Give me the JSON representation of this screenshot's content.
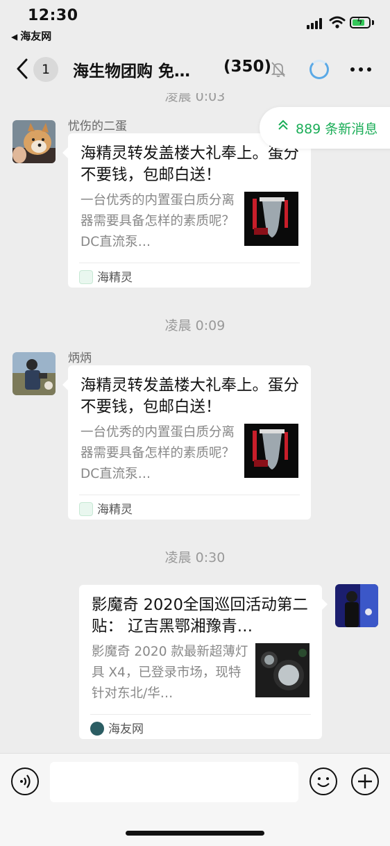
{
  "status_bar": {
    "time": "12:30",
    "back_app": "海友网"
  },
  "nav": {
    "unread_count": "1",
    "title": "海生物团购  免…",
    "member_count": "(350)",
    "icons": [
      "chevron-left-icon",
      "bell-muted-icon",
      "loading-icon",
      "more-icon"
    ]
  },
  "new_messages_pill": "889 条新消息",
  "messages": [
    {
      "timestamp": "凌晨 0:03",
      "sender": "忧伤的二蛋",
      "card": {
        "title": "海精灵转发盖楼大礼奉上。蛋分不要钱，包邮白送！",
        "description": "一台优秀的内置蛋白质分离器需要具备怎样的素质呢？DC直流泵…",
        "source": "海精灵"
      }
    },
    {
      "timestamp": "凌晨 0:09",
      "sender": "炳炳",
      "card": {
        "title": "海精灵转发盖楼大礼奉上。蛋分不要钱，包邮白送！",
        "description": "一台优秀的内置蛋白质分离器需要具备怎样的素质呢？DC直流泵…",
        "source": "海精灵"
      }
    },
    {
      "timestamp": "凌晨 0:30",
      "sender": "",
      "card": {
        "title": "影魔奇 2020全国巡回活动第二贴：  辽吉黑鄂湘豫青…",
        "description": "影魔奇 2020 款最新超薄灯具 X4，已登录市场，现特针对东北/华…",
        "source": "海友网"
      }
    }
  ],
  "input": {
    "placeholder": "",
    "value": ""
  },
  "colors": {
    "accent_green": "#1aad57",
    "background": "#ededed",
    "loading_blue": "#5aa9e6"
  }
}
